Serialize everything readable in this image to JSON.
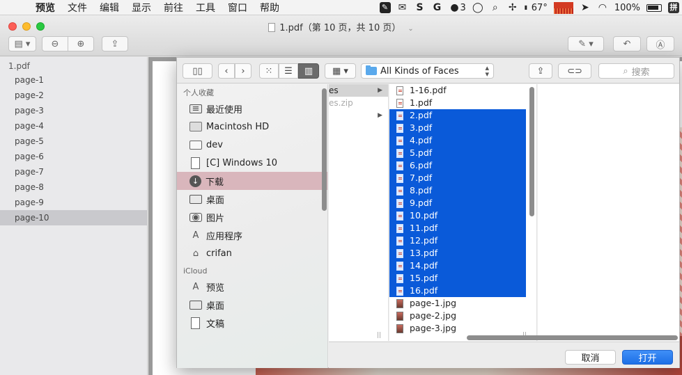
{
  "menubar": {
    "app": "预览",
    "items": [
      "文件",
      "编辑",
      "显示",
      "前往",
      "工具",
      "窗口",
      "帮助"
    ],
    "status": {
      "notification_count": "3",
      "temperature": "67°",
      "battery": "100%",
      "input_method": "拼"
    }
  },
  "window": {
    "title": "1.pdf（第 10 页，共 10 页）"
  },
  "thumbnails": {
    "file": "1.pdf",
    "pages": [
      "page-1",
      "page-2",
      "page-3",
      "page-4",
      "page-5",
      "page-6",
      "page-7",
      "page-8",
      "page-9",
      "page-10"
    ],
    "selected": "page-10"
  },
  "dialog": {
    "location": "All Kinds of Faces",
    "search_placeholder": "搜索",
    "sidebar": {
      "favorites_header": "个人收藏",
      "favorites": [
        "最近使用",
        "Macintosh HD",
        "dev",
        "[C] Windows 10",
        "下载",
        "桌面",
        "图片",
        "应用程序",
        "crifan"
      ],
      "active": "下载",
      "icloud_header": "iCloud",
      "icloud": [
        "预览",
        "桌面",
        "文稿"
      ]
    },
    "column1": [
      "es",
      "es.zip"
    ],
    "files": [
      {
        "name": "1-16.pdf",
        "selected": false,
        "kind": "pdf"
      },
      {
        "name": "1.pdf",
        "selected": false,
        "kind": "pdf"
      },
      {
        "name": "2.pdf",
        "selected": true,
        "kind": "pdf"
      },
      {
        "name": "3.pdf",
        "selected": true,
        "kind": "pdf"
      },
      {
        "name": "4.pdf",
        "selected": true,
        "kind": "pdf"
      },
      {
        "name": "5.pdf",
        "selected": true,
        "kind": "pdf"
      },
      {
        "name": "6.pdf",
        "selected": true,
        "kind": "pdf"
      },
      {
        "name": "7.pdf",
        "selected": true,
        "kind": "pdf"
      },
      {
        "name": "8.pdf",
        "selected": true,
        "kind": "pdf"
      },
      {
        "name": "9.pdf",
        "selected": true,
        "kind": "pdf"
      },
      {
        "name": "10.pdf",
        "selected": true,
        "kind": "pdf"
      },
      {
        "name": "11.pdf",
        "selected": true,
        "kind": "pdf"
      },
      {
        "name": "12.pdf",
        "selected": true,
        "kind": "pdf"
      },
      {
        "name": "13.pdf",
        "selected": true,
        "kind": "pdf"
      },
      {
        "name": "14.pdf",
        "selected": true,
        "kind": "pdf"
      },
      {
        "name": "15.pdf",
        "selected": true,
        "kind": "pdf"
      },
      {
        "name": "16.pdf",
        "selected": true,
        "kind": "pdf"
      },
      {
        "name": "page-1.jpg",
        "selected": false,
        "kind": "jpg"
      },
      {
        "name": "page-2.jpg",
        "selected": false,
        "kind": "jpg"
      },
      {
        "name": "page-3.jpg",
        "selected": false,
        "kind": "jpg"
      }
    ],
    "cancel_label": "取消",
    "open_label": "打开"
  }
}
